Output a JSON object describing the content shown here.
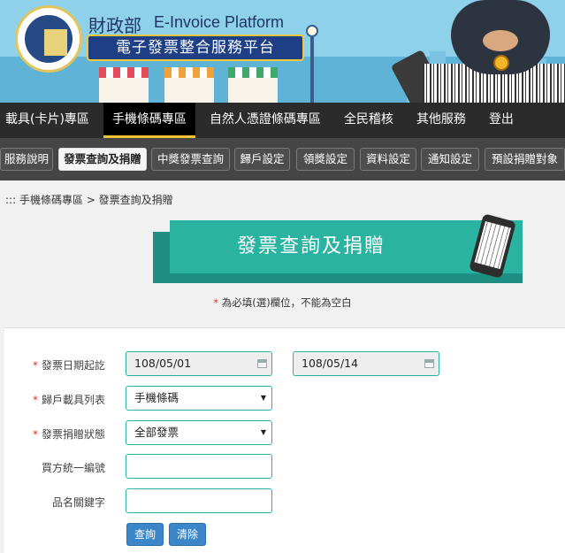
{
  "header": {
    "title_zh": "財政部",
    "title_en": "E-Invoice Platform",
    "subtitle": "電子發票整合服務平台"
  },
  "main_nav": [
    {
      "label": "載具(卡片)專區"
    },
    {
      "label": "手機條碼專區"
    },
    {
      "label": "自然人憑證條碼專區"
    },
    {
      "label": "全民稽核"
    },
    {
      "label": "其他服務"
    },
    {
      "label": "登出"
    }
  ],
  "sub_nav": [
    {
      "label": "服務說明"
    },
    {
      "label": "發票查詢及捐贈"
    },
    {
      "label": "中獎發票查詢"
    },
    {
      "label": "歸戶設定"
    },
    {
      "label": "領獎設定"
    },
    {
      "label": "資料設定"
    },
    {
      "label": "通知設定"
    },
    {
      "label": "預設捐贈對象"
    }
  ],
  "breadcrumb": "::: 手機條碼專區 > 發票查詢及捐贈",
  "page_heading": "發票查詢及捐贈",
  "required_note": {
    "star": "*",
    "text": "為必填(選)欄位，不能為空白"
  },
  "form": {
    "date_label": "發票日期起訖",
    "date_start": "108/05/01",
    "date_end": "108/05/14",
    "carrier_label": "歸戶載具列表",
    "carrier_value": "手機條碼",
    "donation_label": "發票捐贈狀態",
    "donation_value": "全部發票",
    "buyer_id_label": "買方統一編號",
    "buyer_id_value": "",
    "keyword_label": "品名關鍵字",
    "keyword_value": "",
    "required_star": "*",
    "caret": "▼"
  },
  "buttons": {
    "query": "查詢",
    "clear": "清除"
  },
  "colors": {
    "accent_teal": "#2bb3a2",
    "nav_dark": "#2b2b2b",
    "subnav": "#454545",
    "active_underline": "#f1c233",
    "button_blue": "#3a86c8",
    "required_red": "#d9362b"
  }
}
